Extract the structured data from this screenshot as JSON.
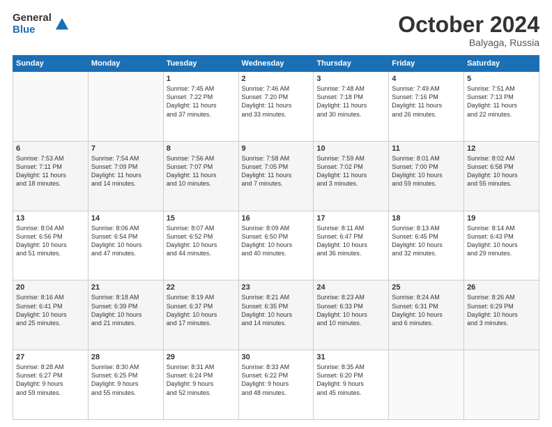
{
  "logo": {
    "general": "General",
    "blue": "Blue"
  },
  "title": "October 2024",
  "location": "Balyaga, Russia",
  "days_header": [
    "Sunday",
    "Monday",
    "Tuesday",
    "Wednesday",
    "Thursday",
    "Friday",
    "Saturday"
  ],
  "weeks": [
    [
      {
        "day": "",
        "sunrise": "",
        "sunset": "",
        "daylight": ""
      },
      {
        "day": "",
        "sunrise": "",
        "sunset": "",
        "daylight": ""
      },
      {
        "day": "1",
        "sunrise": "Sunrise: 7:45 AM",
        "sunset": "Sunset: 7:22 PM",
        "daylight": "Daylight: 11 hours and 37 minutes."
      },
      {
        "day": "2",
        "sunrise": "Sunrise: 7:46 AM",
        "sunset": "Sunset: 7:20 PM",
        "daylight": "Daylight: 11 hours and 33 minutes."
      },
      {
        "day": "3",
        "sunrise": "Sunrise: 7:48 AM",
        "sunset": "Sunset: 7:18 PM",
        "daylight": "Daylight: 11 hours and 30 minutes."
      },
      {
        "day": "4",
        "sunrise": "Sunrise: 7:49 AM",
        "sunset": "Sunset: 7:16 PM",
        "daylight": "Daylight: 11 hours and 26 minutes."
      },
      {
        "day": "5",
        "sunrise": "Sunrise: 7:51 AM",
        "sunset": "Sunset: 7:13 PM",
        "daylight": "Daylight: 11 hours and 22 minutes."
      }
    ],
    [
      {
        "day": "6",
        "sunrise": "Sunrise: 7:53 AM",
        "sunset": "Sunset: 7:11 PM",
        "daylight": "Daylight: 11 hours and 18 minutes."
      },
      {
        "day": "7",
        "sunrise": "Sunrise: 7:54 AM",
        "sunset": "Sunset: 7:09 PM",
        "daylight": "Daylight: 11 hours and 14 minutes."
      },
      {
        "day": "8",
        "sunrise": "Sunrise: 7:56 AM",
        "sunset": "Sunset: 7:07 PM",
        "daylight": "Daylight: 11 hours and 10 minutes."
      },
      {
        "day": "9",
        "sunrise": "Sunrise: 7:58 AM",
        "sunset": "Sunset: 7:05 PM",
        "daylight": "Daylight: 11 hours and 7 minutes."
      },
      {
        "day": "10",
        "sunrise": "Sunrise: 7:59 AM",
        "sunset": "Sunset: 7:02 PM",
        "daylight": "Daylight: 11 hours and 3 minutes."
      },
      {
        "day": "11",
        "sunrise": "Sunrise: 8:01 AM",
        "sunset": "Sunset: 7:00 PM",
        "daylight": "Daylight: 10 hours and 59 minutes."
      },
      {
        "day": "12",
        "sunrise": "Sunrise: 8:02 AM",
        "sunset": "Sunset: 6:58 PM",
        "daylight": "Daylight: 10 hours and 55 minutes."
      }
    ],
    [
      {
        "day": "13",
        "sunrise": "Sunrise: 8:04 AM",
        "sunset": "Sunset: 6:56 PM",
        "daylight": "Daylight: 10 hours and 51 minutes."
      },
      {
        "day": "14",
        "sunrise": "Sunrise: 8:06 AM",
        "sunset": "Sunset: 6:54 PM",
        "daylight": "Daylight: 10 hours and 47 minutes."
      },
      {
        "day": "15",
        "sunrise": "Sunrise: 8:07 AM",
        "sunset": "Sunset: 6:52 PM",
        "daylight": "Daylight: 10 hours and 44 minutes."
      },
      {
        "day": "16",
        "sunrise": "Sunrise: 8:09 AM",
        "sunset": "Sunset: 6:50 PM",
        "daylight": "Daylight: 10 hours and 40 minutes."
      },
      {
        "day": "17",
        "sunrise": "Sunrise: 8:11 AM",
        "sunset": "Sunset: 6:47 PM",
        "daylight": "Daylight: 10 hours and 36 minutes."
      },
      {
        "day": "18",
        "sunrise": "Sunrise: 8:13 AM",
        "sunset": "Sunset: 6:45 PM",
        "daylight": "Daylight: 10 hours and 32 minutes."
      },
      {
        "day": "19",
        "sunrise": "Sunrise: 8:14 AM",
        "sunset": "Sunset: 6:43 PM",
        "daylight": "Daylight: 10 hours and 29 minutes."
      }
    ],
    [
      {
        "day": "20",
        "sunrise": "Sunrise: 8:16 AM",
        "sunset": "Sunset: 6:41 PM",
        "daylight": "Daylight: 10 hours and 25 minutes."
      },
      {
        "day": "21",
        "sunrise": "Sunrise: 8:18 AM",
        "sunset": "Sunset: 6:39 PM",
        "daylight": "Daylight: 10 hours and 21 minutes."
      },
      {
        "day": "22",
        "sunrise": "Sunrise: 8:19 AM",
        "sunset": "Sunset: 6:37 PM",
        "daylight": "Daylight: 10 hours and 17 minutes."
      },
      {
        "day": "23",
        "sunrise": "Sunrise: 8:21 AM",
        "sunset": "Sunset: 6:35 PM",
        "daylight": "Daylight: 10 hours and 14 minutes."
      },
      {
        "day": "24",
        "sunrise": "Sunrise: 8:23 AM",
        "sunset": "Sunset: 6:33 PM",
        "daylight": "Daylight: 10 hours and 10 minutes."
      },
      {
        "day": "25",
        "sunrise": "Sunrise: 8:24 AM",
        "sunset": "Sunset: 6:31 PM",
        "daylight": "Daylight: 10 hours and 6 minutes."
      },
      {
        "day": "26",
        "sunrise": "Sunrise: 8:26 AM",
        "sunset": "Sunset: 6:29 PM",
        "daylight": "Daylight: 10 hours and 3 minutes."
      }
    ],
    [
      {
        "day": "27",
        "sunrise": "Sunrise: 8:28 AM",
        "sunset": "Sunset: 6:27 PM",
        "daylight": "Daylight: 9 hours and 59 minutes."
      },
      {
        "day": "28",
        "sunrise": "Sunrise: 8:30 AM",
        "sunset": "Sunset: 6:25 PM",
        "daylight": "Daylight: 9 hours and 55 minutes."
      },
      {
        "day": "29",
        "sunrise": "Sunrise: 8:31 AM",
        "sunset": "Sunset: 6:24 PM",
        "daylight": "Daylight: 9 hours and 52 minutes."
      },
      {
        "day": "30",
        "sunrise": "Sunrise: 8:33 AM",
        "sunset": "Sunset: 6:22 PM",
        "daylight": "Daylight: 9 hours and 48 minutes."
      },
      {
        "day": "31",
        "sunrise": "Sunrise: 8:35 AM",
        "sunset": "Sunset: 6:20 PM",
        "daylight": "Daylight: 9 hours and 45 minutes."
      },
      {
        "day": "",
        "sunrise": "",
        "sunset": "",
        "daylight": ""
      },
      {
        "day": "",
        "sunrise": "",
        "sunset": "",
        "daylight": ""
      }
    ]
  ]
}
